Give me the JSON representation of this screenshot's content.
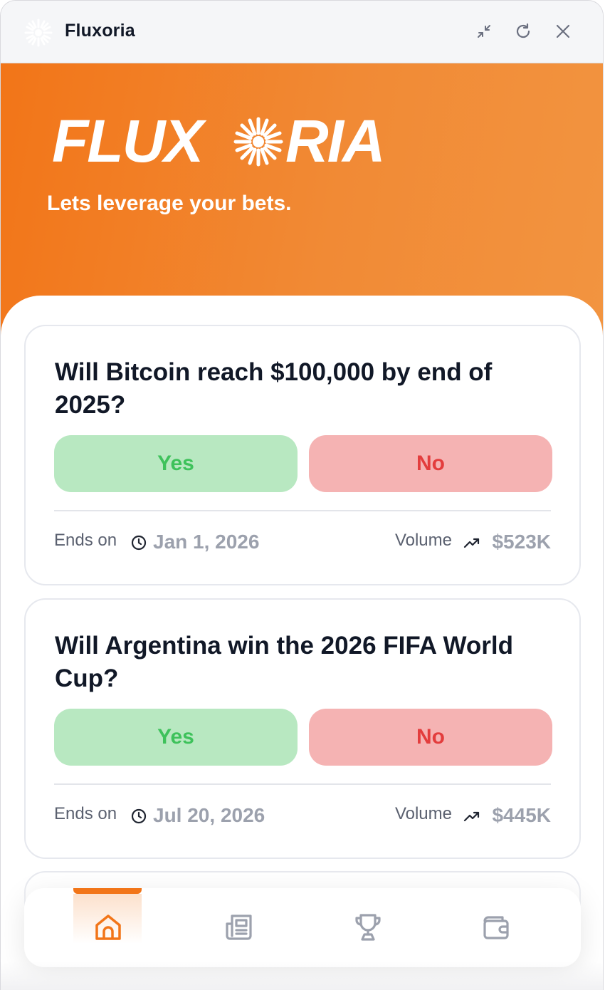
{
  "window": {
    "title": "Fluxoria",
    "app_icon": "sunburst-icon",
    "controls": [
      "minimize-arrows-icon",
      "refresh-icon",
      "close-icon"
    ]
  },
  "hero": {
    "logo_text": "FLUXORIA",
    "tagline": "Lets leverage your bets.",
    "gradient_colors": [
      "#f27518",
      "#f29440"
    ]
  },
  "markets": [
    {
      "question": "Will Bitcoin reach $100,000 by end of 2025?",
      "yes_label": "Yes",
      "no_label": "No",
      "ends_label": "Ends on",
      "ends_date": "Jan 1, 2026",
      "volume_label": "Volume",
      "volume_value": "$523K"
    },
    {
      "question": "Will Argentina win the 2026 FIFA World Cup?",
      "yes_label": "Yes",
      "no_label": "No",
      "ends_label": "Ends on",
      "ends_date": "Jul 20, 2026",
      "volume_label": "Volume",
      "volume_value": "$445K"
    }
  ],
  "nav": {
    "items": [
      {
        "icon": "home-icon",
        "active": true
      },
      {
        "icon": "newspaper-icon",
        "active": false
      },
      {
        "icon": "trophy-icon",
        "active": false
      },
      {
        "icon": "wallet-icon",
        "active": false
      }
    ],
    "accent": "#f27518",
    "inactive_color": "#9ca1ad"
  },
  "colors": {
    "yes_bg": "#b8e8c1",
    "yes_text": "#3ec25b",
    "no_bg": "#f5b3b3",
    "no_text": "#e33d3d"
  }
}
